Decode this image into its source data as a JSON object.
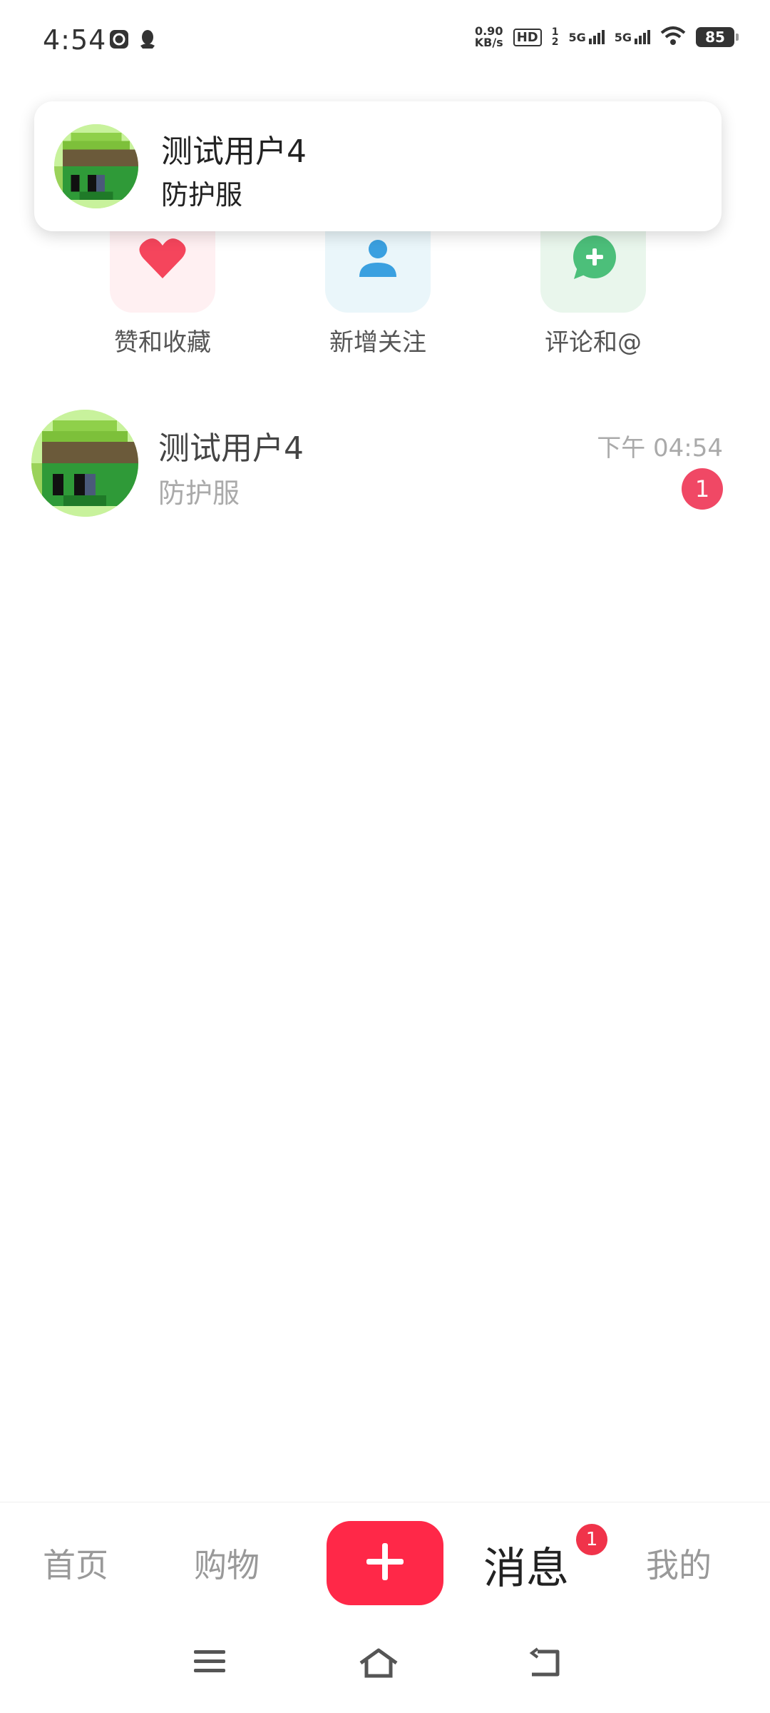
{
  "status_bar": {
    "time": "4:54",
    "net_speed_value": "0.90",
    "net_speed_unit": "KB/s",
    "hd": "HD",
    "hd_sub": "1",
    "hd_sub2": "2",
    "signal_1": "5G",
    "signal_2": "5G",
    "battery": "85"
  },
  "notification": {
    "name": "测试用户4",
    "text": "防护服"
  },
  "categories": [
    {
      "label": "赞和收藏",
      "icon": "heart-icon",
      "bg": "#fff0f2",
      "color": "#f5455c"
    },
    {
      "label": "新增关注",
      "icon": "person-icon",
      "bg": "#eaf6fa",
      "color": "#3aa0e0"
    },
    {
      "label": "评论和@",
      "icon": "chat-plus-icon",
      "bg": "#e9f6ec",
      "color": "#4cbf7a"
    }
  ],
  "conversation": {
    "name": "测试用户4",
    "message": "防护服",
    "time": "下午 04:54",
    "unread": "1"
  },
  "tabbar": {
    "home": "首页",
    "shop": "购物",
    "messages": "消息",
    "messages_badge": "1",
    "me": "我的"
  },
  "colors": {
    "accent": "#ff2848",
    "badge": "#f04865"
  }
}
